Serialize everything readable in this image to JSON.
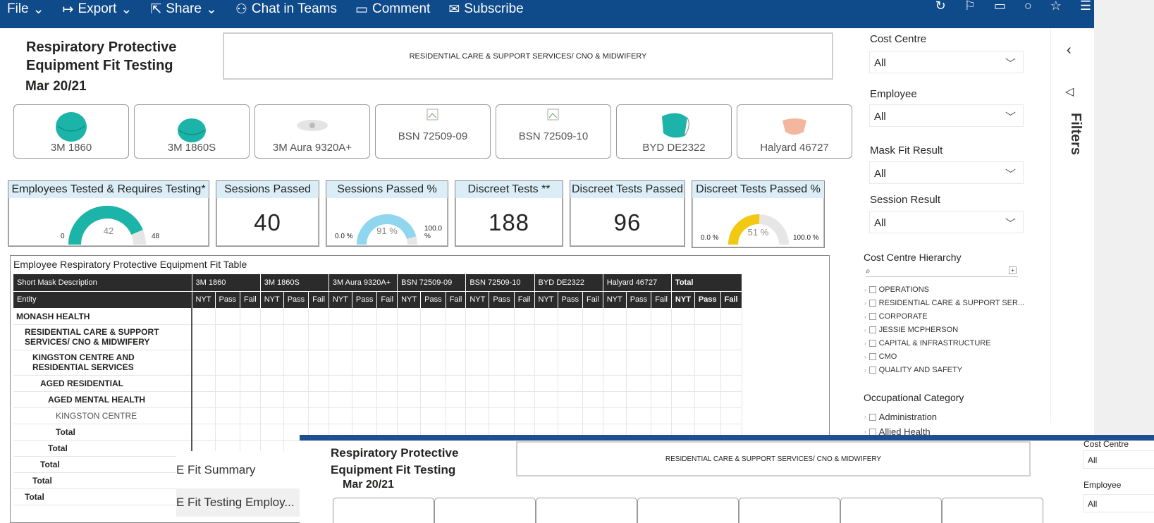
{
  "toolbar": {
    "file": "File",
    "export": "Export",
    "share": "Share",
    "chat": "Chat in Teams",
    "comment": "Comment",
    "subscribe": "Subscribe"
  },
  "report": {
    "title": "Respiratory Protective Equipment Fit Testing",
    "date": "Mar 20/21",
    "banner": "RESIDENTIAL CARE & SUPPORT SERVICES/ CNO & MIDWIFERY"
  },
  "masks": [
    "3M 1860",
    "3M 1860S",
    "3M Aura 9320A+",
    "BSN 72509-09",
    "BSN 72509-10",
    "BYD DE2322",
    "Halyard 46727"
  ],
  "kpis": {
    "employees": {
      "label": "Employees Tested & Requires Testing*",
      "min": "0",
      "value": "42",
      "max": "48",
      "fraction": 0.875
    },
    "sessions_passed": {
      "label": "Sessions Passed",
      "value": "40"
    },
    "sessions_pct": {
      "label": "Sessions Passed %",
      "min": "0.0 %",
      "value": "91 %",
      "max": "100.0 %",
      "fraction": 0.91
    },
    "discreet": {
      "label": "Discreet Tests **",
      "value": "188"
    },
    "discreet_passed": {
      "label": "Discreet Tests Passed",
      "value": "96"
    },
    "discreet_pct": {
      "label": "Discreet Tests Passed %",
      "min": "0.0 %",
      "value": "51 %",
      "max": "100.0 %",
      "fraction": 0.51
    }
  },
  "table": {
    "title": "Employee Respiratory Protective Equipment Fit Table",
    "h1": "Short Mask Description",
    "h2": "Entity",
    "total": "Total",
    "sub": {
      "nyt": "NYT",
      "pass": "Pass",
      "fail": "Fail"
    },
    "rows": [
      "MONASH HEALTH",
      "RESIDENTIAL CARE & SUPPORT SERVICES/ CNO & MIDWIFERY",
      "KINGSTON CENTRE AND RESIDENTIAL SERVICES",
      "AGED RESIDENTIAL",
      "AGED MENTAL HEALTH",
      "KINGSTON CENTRE",
      "Total",
      "Total",
      "Total",
      "Total",
      "Total"
    ]
  },
  "filters": {
    "cost_centre": {
      "label": "Cost Centre",
      "value": "All"
    },
    "employee": {
      "label": "Employee",
      "value": "All"
    },
    "mask_fit": {
      "label": "Mask Fit Result",
      "value": "All"
    },
    "session": {
      "label": "Session Result",
      "value": "All"
    },
    "hierarchy": {
      "label": "Cost Centre Hierarchy",
      "items": [
        "OPERATIONS",
        "RESIDENTIAL CARE & SUPPORT SER...",
        "CORPORATE",
        "JESSIE MCPHERSON",
        "CAPITAL & INFRASTRUCTURE",
        "CMO",
        "QUALITY AND SAFETY"
      ]
    },
    "occupational": {
      "label": "Occupational Category",
      "items": [
        "Administration",
        "Allied Health"
      ]
    },
    "pane_label": "Filters"
  },
  "nav": {
    "item1": "E Fit Summary",
    "item2": "E Fit Testing Employ..."
  },
  "colors": {
    "teal": "#1cb3a8",
    "lightblue": "#8fd6ee",
    "yellow": "#f2c811",
    "header": "#0f4a8a"
  }
}
